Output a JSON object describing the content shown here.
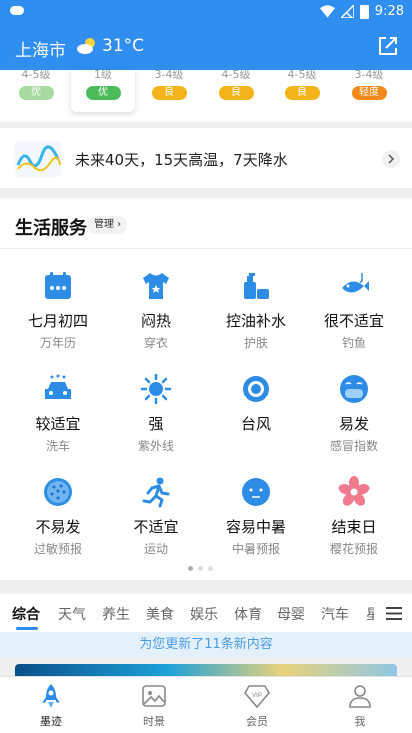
{
  "status_bar": {
    "time": "9:28"
  },
  "header": {
    "city": "上海市",
    "temperature": "31°C"
  },
  "forecast_strip": [
    {
      "level": "4-5级",
      "aqi": "优",
      "color": "#a8dba0"
    },
    {
      "level": "1级",
      "aqi": "优",
      "color": "#4cbb5a"
    },
    {
      "level": "3-4级",
      "aqi": "良",
      "color": "#f2b31b"
    },
    {
      "level": "4-5级",
      "aqi": "良",
      "color": "#f2b31b"
    },
    {
      "level": "4-5级",
      "aqi": "良",
      "color": "#f2b31b"
    },
    {
      "level": "3-4级",
      "aqi": "轻度",
      "color": "#f28a1b"
    }
  ],
  "promo": {
    "text": "未来40天，15天高温，7天降水"
  },
  "life_services": {
    "title": "生活服务",
    "manage_label": "管理 ›",
    "items": [
      {
        "value": "七月初四",
        "sub": "万年历",
        "icon": "calendar-icon"
      },
      {
        "value": "闷热",
        "sub": "穿衣",
        "icon": "shirt-icon"
      },
      {
        "value": "控油补水",
        "sub": "护肤",
        "icon": "skincare-icon"
      },
      {
        "value": "很不适宜",
        "sub": "钓鱼",
        "icon": "fish-icon"
      },
      {
        "value": "较适宜",
        "sub": "洗车",
        "icon": "car-wash-icon"
      },
      {
        "value": "强",
        "sub": "紫外线",
        "icon": "sun-icon"
      },
      {
        "value": "台风",
        "sub": "",
        "icon": "typhoon-icon"
      },
      {
        "value": "易发",
        "sub": "感冒指数",
        "icon": "mask-face-icon"
      },
      {
        "value": "不易发",
        "sub": "过敏预报",
        "icon": "pollen-icon"
      },
      {
        "value": "不适宜",
        "sub": "运动",
        "icon": "runner-icon"
      },
      {
        "value": "容易中暑",
        "sub": "中暑预报",
        "icon": "heatstroke-face-icon"
      },
      {
        "value": "结束日",
        "sub": "樱花预报",
        "icon": "sakura-icon"
      }
    ]
  },
  "news_tabs": [
    "综合",
    "天气",
    "养生",
    "美食",
    "娱乐",
    "体育",
    "母婴",
    "汽车",
    "星"
  ],
  "update_banner": "为您更新了11条新内容",
  "bottom_nav": [
    {
      "label": "墨迹",
      "icon": "rocket-icon",
      "active": true
    },
    {
      "label": "时景",
      "icon": "photo-icon",
      "active": false
    },
    {
      "label": "会员",
      "icon": "vip-icon",
      "active": false
    },
    {
      "label": "我",
      "icon": "profile-icon",
      "active": false
    }
  ],
  "colors": {
    "primary": "#2f8ef0",
    "icon_blue": "#2d8de6",
    "sakura": "#f07b8e"
  }
}
